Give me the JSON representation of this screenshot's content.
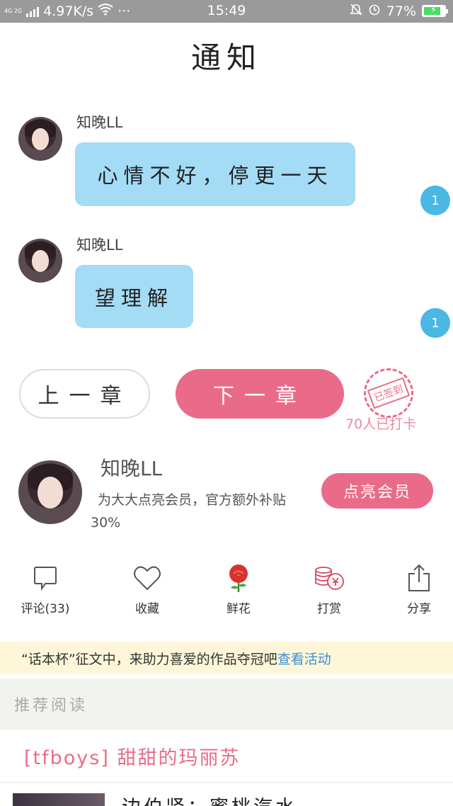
{
  "status_bar": {
    "network": "4G 2G",
    "speed": "4.97K/s",
    "more": "···",
    "time": "15:49",
    "battery": "77%",
    "battery_level": 0.77
  },
  "page_title": "通知",
  "messages": [
    {
      "sender": "知晚LL",
      "text": "心情不好，停更一天",
      "badge": "1"
    },
    {
      "sender": "知晚LL",
      "text": "望理解",
      "badge": "1"
    }
  ],
  "chapter_nav": {
    "prev_label": "上一章",
    "next_label": "下一章",
    "stamp_label": "已签到",
    "checkin_count": "70人已打卡"
  },
  "member": {
    "author_name": "知晚LL",
    "description": "为大大点亮会员，官方额外补贴30%",
    "button_label": "点亮会员"
  },
  "actions": [
    {
      "label": "评论(33)",
      "icon": "comment-icon"
    },
    {
      "label": "收藏",
      "icon": "heart-icon"
    },
    {
      "label": "鲜花",
      "icon": "rose-icon"
    },
    {
      "label": "打赏",
      "icon": "coins-icon"
    },
    {
      "label": "分享",
      "icon": "share-icon"
    }
  ],
  "banner": {
    "text": "“话本杯”征文中，来助力喜爱的作品夺冠吧",
    "link": "查看活动"
  },
  "recommend": {
    "header": "推荐阅读",
    "items": [
      {
        "title": "[tfboys] 甜甜的玛丽苏"
      },
      {
        "title": "边伯贤：蜜桃汽水"
      }
    ]
  },
  "colors": {
    "accent_pink": "#ea6b89",
    "bubble_blue": "#a4dbf5",
    "badge_blue": "#4ab7e4",
    "banner_bg": "#fdf6d8",
    "link_blue": "#3b8fd6"
  }
}
